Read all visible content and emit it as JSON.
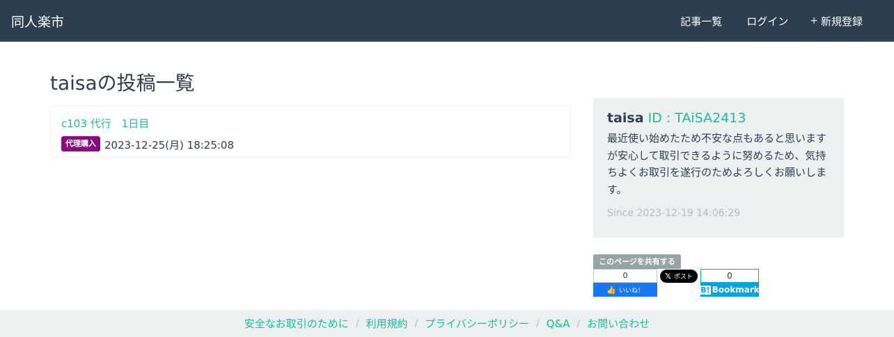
{
  "navbar": {
    "brand": "同人楽市",
    "items": [
      {
        "icon": "",
        "label": "記事一覧"
      },
      {
        "icon": "",
        "label": "ログイン"
      },
      {
        "icon": "+",
        "label": "新規登録"
      }
    ]
  },
  "page": {
    "title": "taisaの投稿一覧"
  },
  "posts": [
    {
      "title": "c103 代行　1日目",
      "badge": "代理購入",
      "date": "2023-12-25(月) 18:25:08"
    }
  ],
  "profile": {
    "icon": "",
    "name": "taisa",
    "id": "ID : TAiSA2413",
    "bio": "最近使い始めたため不安な点もあると思いますが安心して取引できるように努めるため、気持ちよくお取引を遂行のためよろしくお願いします。",
    "since_icon": "",
    "since": "Since 2023-12-19 14:06:29"
  },
  "share": {
    "label": "このページを共有する",
    "facebook": {
      "count": "0",
      "icon": "👍",
      "label": "いいね！"
    },
    "twitter": {
      "icon": "𝕏",
      "label": "ポスト"
    },
    "hatena": {
      "count": "0",
      "icon": "B!",
      "label": "Bookmark"
    }
  },
  "footer": {
    "links": [
      "安全なお取引のために",
      "利用規約",
      "プライバシーポリシー",
      "Q&A",
      "お問い合わせ"
    ],
    "separator": "/"
  },
  "colors": {
    "navbar": "#2c3e50",
    "accent": "#18bc9c",
    "badge": "#8a0d7e",
    "panel": "#ecf0f1"
  }
}
